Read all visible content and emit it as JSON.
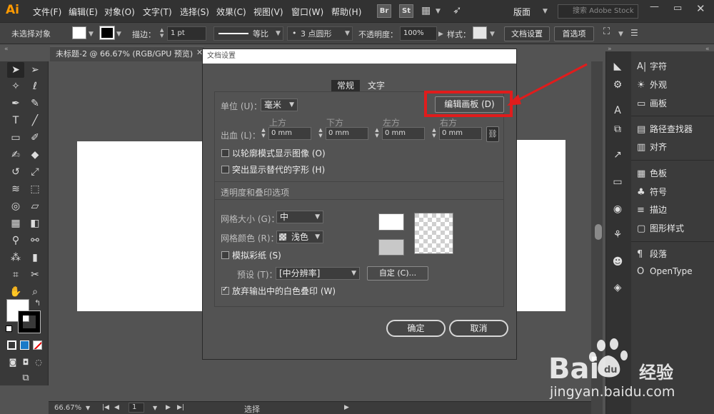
{
  "app": {
    "logo": "Ai",
    "menu": [
      "文件(F)",
      "编辑(E)",
      "对象(O)",
      "文字(T)",
      "选择(S)",
      "效果(C)",
      "视图(V)",
      "窗口(W)",
      "帮助(H)"
    ],
    "bridge": "Br",
    "stock": "St",
    "workspace": "版面",
    "search_placeholder": "搜索 Adobe Stock"
  },
  "controlbar": {
    "selection": "未选择对象",
    "stroke_label": "描边：",
    "stroke_value": "1 pt",
    "stroke_profile": "等比",
    "brush": "3 点圆形",
    "opacity_label": "不透明度：",
    "opacity_value": "100%",
    "style_label": "样式：",
    "doc_setup": "文档设置",
    "preferences": "首选项"
  },
  "document": {
    "tab_title": "未标题-2 @ 66.67% (RGB/GPU 预览)"
  },
  "statusbar": {
    "zoom": "66.67%",
    "page": "1",
    "tool": "选择"
  },
  "panels": [
    {
      "icon": "A|",
      "label": "字符"
    },
    {
      "icon": "☀",
      "label": "外观"
    },
    {
      "icon": "▭",
      "label": "画板"
    },
    {
      "icon": "▤",
      "label": "路径查找器"
    },
    {
      "icon": "▥",
      "label": "对齐"
    },
    {
      "icon": "▦",
      "label": "色板"
    },
    {
      "icon": "♣",
      "label": "符号"
    },
    {
      "icon": "≡",
      "label": "描边"
    },
    {
      "icon": "▢",
      "label": "图形样式"
    },
    {
      "icon": "¶",
      "label": "段落"
    },
    {
      "icon": "O",
      "label": "OpenType"
    }
  ],
  "dialog": {
    "title": "文档设置",
    "tab_general": "常规",
    "tab_text": "文字",
    "units_label": "单位 (U)：",
    "units_value": "毫米",
    "edit_artboards": "编辑画板 (D)",
    "bleed_label": "出血 (L)：",
    "bleed": [
      {
        "caption": "上方",
        "value": "0 mm"
      },
      {
        "caption": "下方",
        "value": "0 mm"
      },
      {
        "caption": "左方",
        "value": "0 mm"
      },
      {
        "caption": "右方",
        "value": "0 mm"
      }
    ],
    "outline_mode": "以轮廓模式显示图像 (O)",
    "highlight_glyphs": "突出显示替代的字形 (H)",
    "transparency_header": "透明度和叠印选项",
    "grid_size_label": "网格大小 (G)：",
    "grid_size_value": "中",
    "grid_color_label": "网格颜色 (R)：",
    "grid_color_value": "浅色",
    "simulate_paper": "模拟彩纸 (S)",
    "preset_label": "预设 (T)：",
    "preset_value": "[中分辨率]",
    "custom_button": "自定 (C)...",
    "discard_white": "放弃输出中的白色叠印 (W)",
    "ok": "确定",
    "cancel": "取消"
  },
  "watermark": {
    "brand": "Bai",
    "jingyan": "经验",
    "url": "jingyan.baidu.com"
  },
  "colors": {
    "highlight": "#e01c1c",
    "logo": "#ff9a00"
  }
}
